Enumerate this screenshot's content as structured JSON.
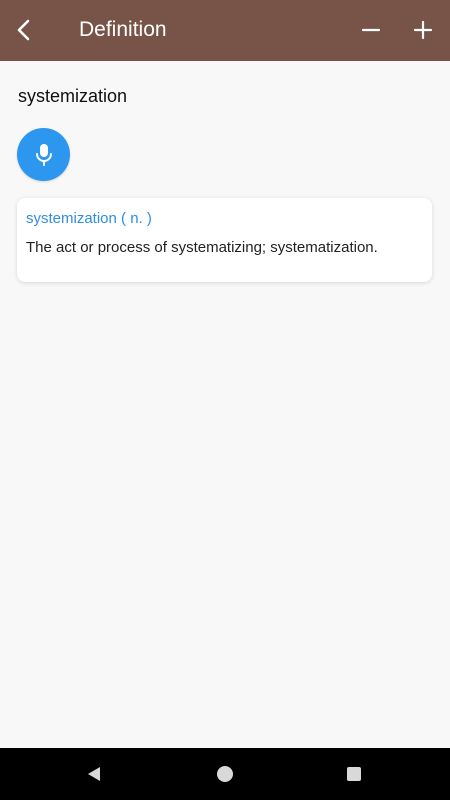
{
  "app_bar": {
    "title": "Definition",
    "back_icon": "chevron-left-icon",
    "zoom_out_icon": "minus-icon",
    "zoom_in_icon": "plus-icon",
    "color": "#785448"
  },
  "search": {
    "word": "systemization"
  },
  "voice": {
    "icon": "mic-icon",
    "color": "#2d96ee"
  },
  "entry": {
    "headword": "systemization ( n. )",
    "definition": "The act or process of systematizing; systematization.",
    "headword_color": "#2e8ee0"
  },
  "system_nav": {
    "back_icon": "nav-back-icon",
    "home_icon": "nav-home-icon",
    "recents_icon": "nav-recents-icon"
  }
}
